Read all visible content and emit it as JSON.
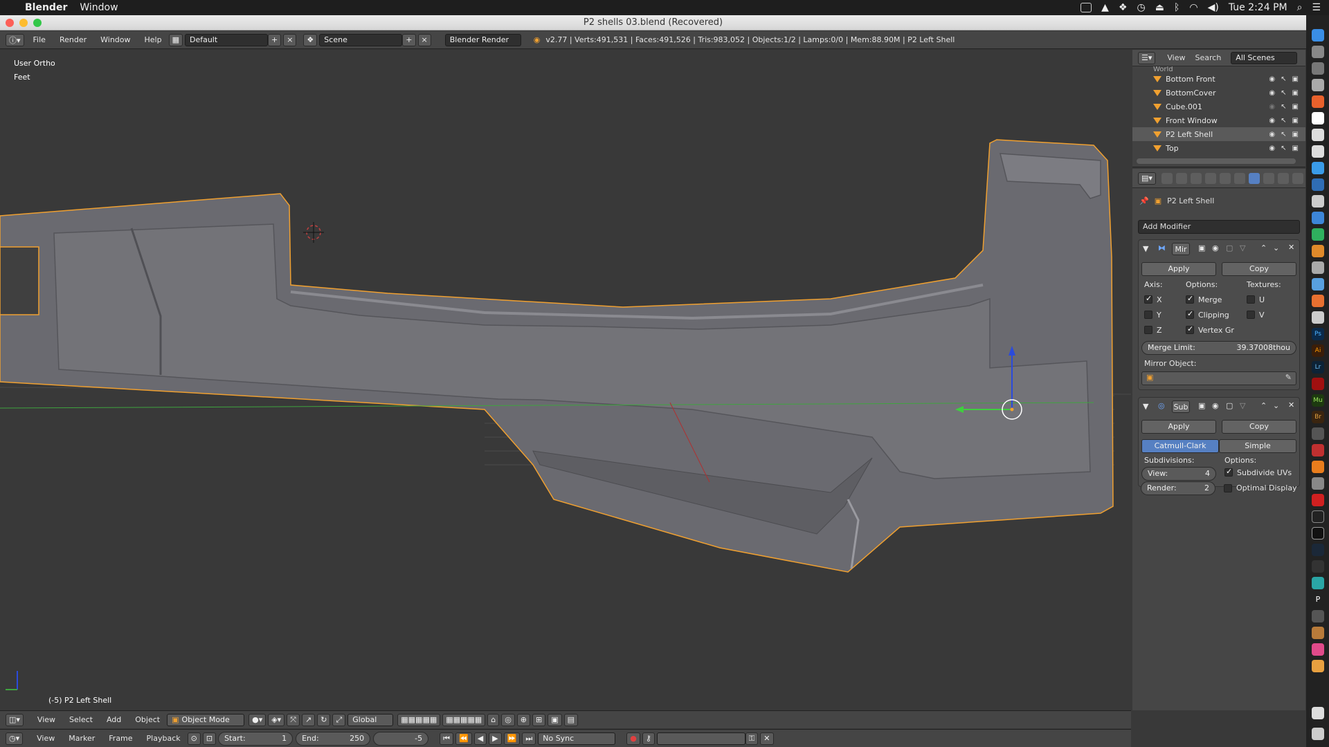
{
  "macbar": {
    "app_name": "Blender",
    "menu_window": "Window",
    "clock": "Tue 2:24 PM"
  },
  "window": {
    "title": "P2 shells 03.blend (Recovered)"
  },
  "header": {
    "menus": [
      "File",
      "Render",
      "Window",
      "Help"
    ],
    "layout": "Default",
    "scene": "Scene",
    "engine": "Blender Render",
    "stats": "v2.77 | Verts:491,531 | Faces:491,526 | Tris:983,052 | Objects:1/2 | Lamps:0/0 | Mem:88.90M | P2 Left Shell"
  },
  "viewport": {
    "view_name": "User Ortho",
    "units": "Feet",
    "object_label": "(-5) P2 Left Shell"
  },
  "outliner": {
    "tabs": [
      "View",
      "Search"
    ],
    "filter": "All Scenes",
    "partial_item": "World",
    "items": [
      {
        "name": "Bottom Front",
        "selected": false
      },
      {
        "name": "BottomCover",
        "selected": false
      },
      {
        "name": "Cube.001",
        "selected": false
      },
      {
        "name": "Front Window",
        "selected": false
      },
      {
        "name": "P2 Left Shell",
        "selected": true
      },
      {
        "name": "Top",
        "selected": false
      }
    ]
  },
  "properties": {
    "object_name": "P2 Left Shell",
    "add_modifier": "Add Modifier",
    "mirror": {
      "name": "Mir",
      "apply": "Apply",
      "copy": "Copy",
      "axis_label": "Axis:",
      "options_label": "Options:",
      "textures_label": "Textures:",
      "axes": [
        {
          "label": "X",
          "on": true
        },
        {
          "label": "Y",
          "on": false
        },
        {
          "label": "Z",
          "on": false
        }
      ],
      "options": [
        {
          "label": "Merge",
          "on": true
        },
        {
          "label": "Clipping",
          "on": true
        },
        {
          "label": "Vertex Gr",
          "on": true
        }
      ],
      "textures": [
        {
          "label": "U",
          "on": false
        },
        {
          "label": "V",
          "on": false
        }
      ],
      "merge_limit_label": "Merge Limit:",
      "merge_limit_value": "39.37008thou",
      "mirror_object_label": "Mirror Object:"
    },
    "subsurf": {
      "name": "Sub",
      "apply": "Apply",
      "copy": "Copy",
      "mode_catmull": "Catmull-Clark",
      "mode_simple": "Simple",
      "subdivisions_label": "Subdivisions:",
      "options_label": "Options:",
      "view_label": "View:",
      "view_value": "4",
      "render_label": "Render:",
      "render_value": "2",
      "opt_subdivide_uvs": "Subdivide UVs",
      "opt_subdivide_uvs_on": true,
      "opt_optimal": "Optimal Display",
      "opt_optimal_on": false
    }
  },
  "viewport_header": {
    "menus": [
      "View",
      "Select",
      "Add",
      "Object"
    ],
    "mode": "Object Mode",
    "orientation": "Global"
  },
  "timeline": {
    "menus": [
      "View",
      "Marker",
      "Frame",
      "Playback"
    ],
    "start_label": "Start:",
    "start_value": "1",
    "end_label": "End:",
    "end_value": "250",
    "current_frame": "-5",
    "sync": "No Sync"
  },
  "colors": {
    "accent_blue": "#5680c2",
    "selection_orange": "#f0a030",
    "viewport_bg": "#393939"
  }
}
